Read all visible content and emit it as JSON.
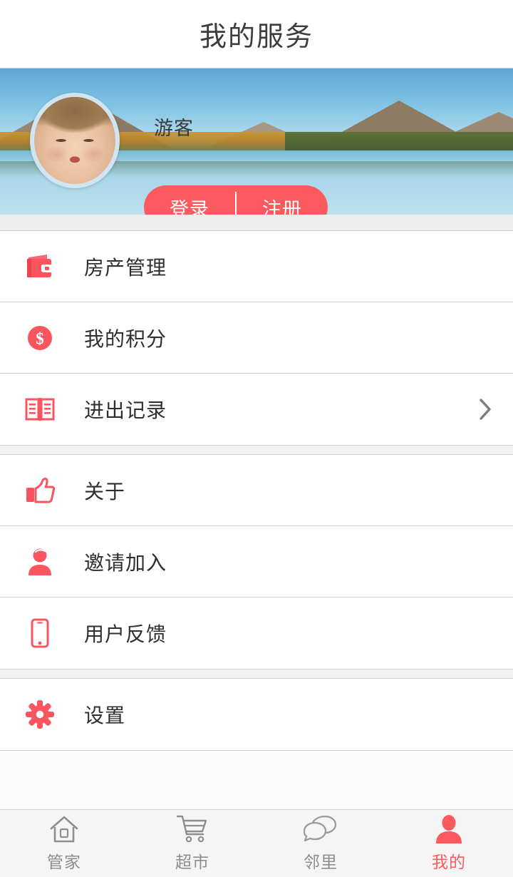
{
  "header": {
    "title": "我的服务"
  },
  "banner": {
    "user_name": "游客",
    "avatar_name": "user-avatar",
    "background_name": "lake-mountain-photo",
    "login_label": "登录",
    "register_label": "注册",
    "accent_color": "#fb5a5f"
  },
  "menu_groups": [
    {
      "items": [
        {
          "label": "房产管理",
          "icon": "wallet-icon",
          "has_chevron": false
        },
        {
          "label": "我的积分",
          "icon": "coin-dollar-icon",
          "has_chevron": false
        },
        {
          "label": "进出记录",
          "icon": "book-icon",
          "has_chevron": true
        }
      ]
    },
    {
      "items": [
        {
          "label": "关于",
          "icon": "thumbs-up-icon",
          "has_chevron": false
        },
        {
          "label": "邀请加入",
          "icon": "person-icon",
          "has_chevron": false
        },
        {
          "label": "用户反馈",
          "icon": "mobile-phone-icon",
          "has_chevron": false
        }
      ]
    },
    {
      "items": [
        {
          "label": "设置",
          "icon": "gear-icon",
          "has_chevron": false
        }
      ]
    }
  ],
  "tabbar": {
    "items": [
      {
        "label": "管家",
        "icon": "house-icon",
        "active": false
      },
      {
        "label": "超市",
        "icon": "shopping-cart-icon",
        "active": false
      },
      {
        "label": "邻里",
        "icon": "chat-bubbles-icon",
        "active": false
      },
      {
        "label": "我的",
        "icon": "person-filled-icon",
        "active": true
      }
    ],
    "active_color": "#fb5a5f",
    "inactive_color": "#8e8e8e"
  }
}
